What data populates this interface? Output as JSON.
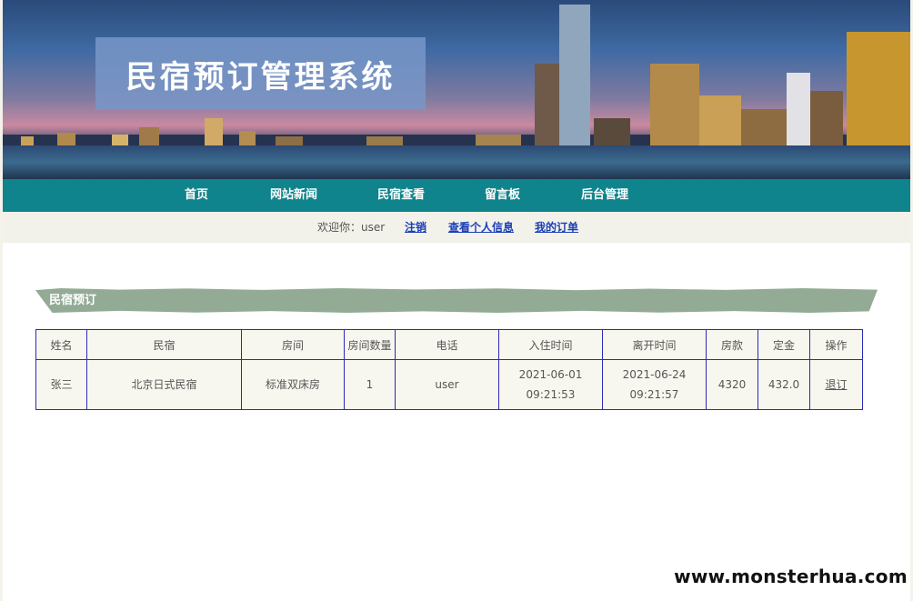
{
  "header": {
    "site_title": "民宿预订管理系统"
  },
  "nav": {
    "items": [
      {
        "label": "首页"
      },
      {
        "label": "网站新闻"
      },
      {
        "label": "民宿查看"
      },
      {
        "label": "留言板"
      },
      {
        "label": "后台管理"
      }
    ]
  },
  "userbar": {
    "welcome": "欢迎你：user",
    "logout": "注销",
    "profile": "查看个人信息",
    "orders": "我的订单"
  },
  "section": {
    "title": "民宿预订"
  },
  "table": {
    "headers": [
      "姓名",
      "民宿",
      "房间",
      "房间数量",
      "电话",
      "入住时间",
      "离开时间",
      "房款",
      "定金",
      "操作"
    ],
    "rows": [
      {
        "name": "张三",
        "homestay": "北京日式民宿",
        "room": "标准双床房",
        "room_count": "1",
        "phone": "user",
        "checkin_date": "2021-06-01",
        "checkin_time": "09:21:53",
        "checkout_date": "2021-06-24",
        "checkout_time": "09:21:57",
        "price": "4320",
        "deposit": "432.0",
        "action": "退订"
      }
    ]
  },
  "watermark": "www.monsterhua.com",
  "colors": {
    "nav_bg": "#10848c",
    "link": "#1a3fb8",
    "table_border": "#2a2ab8",
    "section_bar": "#93ab95"
  }
}
